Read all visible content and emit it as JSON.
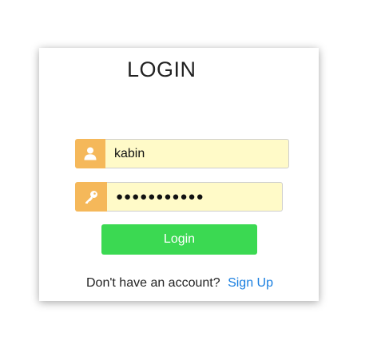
{
  "form": {
    "title": "LOGIN",
    "username": {
      "value": "kabin",
      "icon": "user-icon"
    },
    "password": {
      "value": "●●●●●●●●●●●",
      "icon": "key-icon"
    },
    "login_label": "Login",
    "signup_prompt": "Don't have an account?",
    "signup_link": "Sign Up"
  },
  "colors": {
    "icon_bg": "#f5b85a",
    "input_bg": "#fffac8",
    "button": "#3bd952",
    "link": "#1a7fe0"
  }
}
